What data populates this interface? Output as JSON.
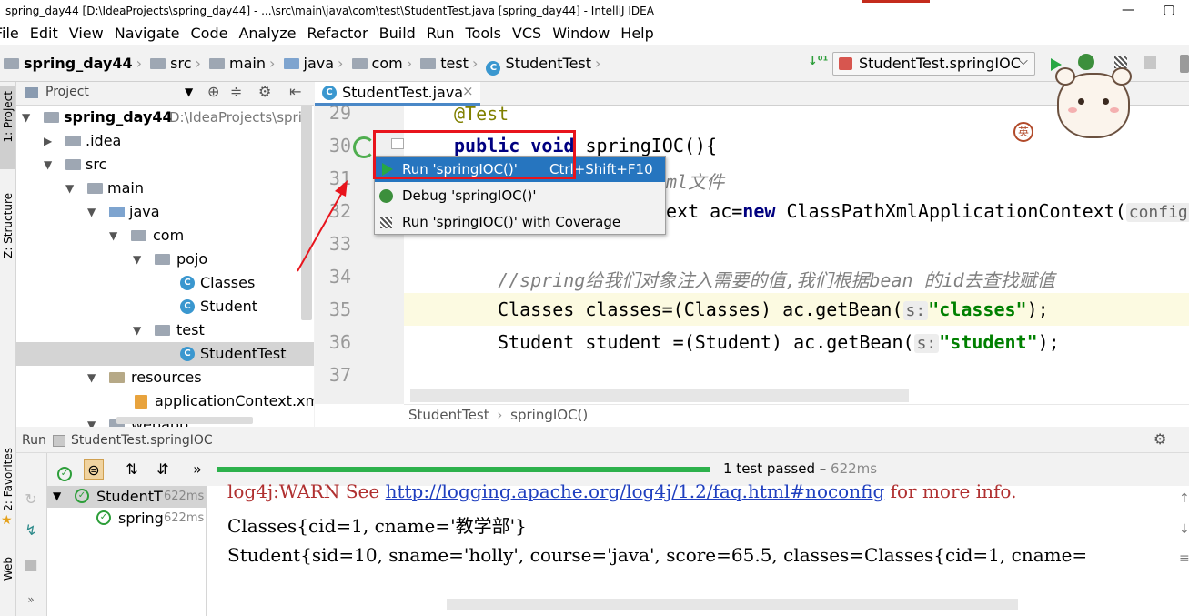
{
  "window": {
    "title": "spring_day44 [D:\\IdeaProjects\\spring_day44] - ...\\src\\main\\java\\com\\test\\StudentTest.java [spring_day44] - IntelliJ IDEA",
    "minimize": "—",
    "maximize": "▢"
  },
  "menu": [
    "File",
    "Edit",
    "View",
    "Navigate",
    "Code",
    "Analyze",
    "Refactor",
    "Build",
    "Run",
    "Tools",
    "VCS",
    "Window",
    "Help"
  ],
  "breadcrumbs": [
    "spring_day44",
    "src",
    "main",
    "java",
    "com",
    "test",
    "StudentTest"
  ],
  "run_config": "StudentTest.springIOC",
  "side_tabs": {
    "project": "1: Project",
    "structure": "Z: Structure",
    "favorites": "2: Favorites",
    "web": "Web"
  },
  "project_panel": {
    "title": "Project",
    "root_name": "spring_day44",
    "root_path": "D:\\IdeaProjects\\sprin",
    "items": [
      ".idea",
      "src",
      "main",
      "java",
      "com",
      "pojo",
      "Classes",
      "Student",
      "test",
      "StudentTest",
      "resources",
      "applicationContext.xml",
      "webapp"
    ]
  },
  "editor": {
    "tab": "StudentTest.java",
    "tab_close": "×",
    "line_numbers": [
      "29",
      "30",
      "31",
      "32",
      "33",
      "34",
      "35",
      "36",
      "37"
    ],
    "code": {
      "l29": "@Test",
      "l30_kw": "public void",
      "l30_rest": " springIOC(){",
      "l31": "ml文件",
      "l32_a": "ext ac=",
      "l32_kw": "new",
      "l32_b": " ClassPathXmlApplicationContext(",
      "l32_hint": "config",
      "l34": "//spring给我们对象注入需要的值,我们根据bean 的id去查找赋值",
      "l35_a": "Classes classes=(Classes) ac.getBean(",
      "l35_hint": "s:",
      "l35_str": "\"classes\"",
      "l35_b": ");",
      "l36_a": "Student student =(Student) ac.getBean(",
      "l36_hint": "s:",
      "l36_str": "\"student\"",
      "l36_b": ");"
    },
    "breadcrumb_class": "StudentTest",
    "breadcrumb_method": "springIOC()"
  },
  "context_menu": [
    {
      "label": "Run 'springIOC()'",
      "shortcut": "Ctrl+Shift+F10"
    },
    {
      "label": "Debug 'springIOC()'",
      "shortcut": ""
    },
    {
      "label": "Run 'springIOC()' with Coverage",
      "shortcut": ""
    }
  ],
  "run_panel": {
    "label": "Run",
    "config": "StudentTest.springIOC",
    "status": "1 test passed",
    "status_time": "622ms",
    "tests": [
      {
        "name": "StudentT",
        "time": "622ms"
      },
      {
        "name": "spring",
        "time": "622ms"
      }
    ],
    "console": {
      "warn_prefix": "log4j:WARN See ",
      "warn_link": "http://logging.apache.org/log4j/1.2/faq.html#noconfig",
      "warn_suffix": " for more info.",
      "line1": "Classes{cid=1, cname='教学部'}",
      "line2": "Student{sid=10, sname='holly', course='java', score=65.5, classes=Classes{cid=1, cname="
    }
  },
  "colors": {
    "selection": "#2675bf",
    "red_annotation": "#e8141c",
    "run_green": "#27a744",
    "progress_green": "#2db14c"
  },
  "mascot_badge": "英"
}
